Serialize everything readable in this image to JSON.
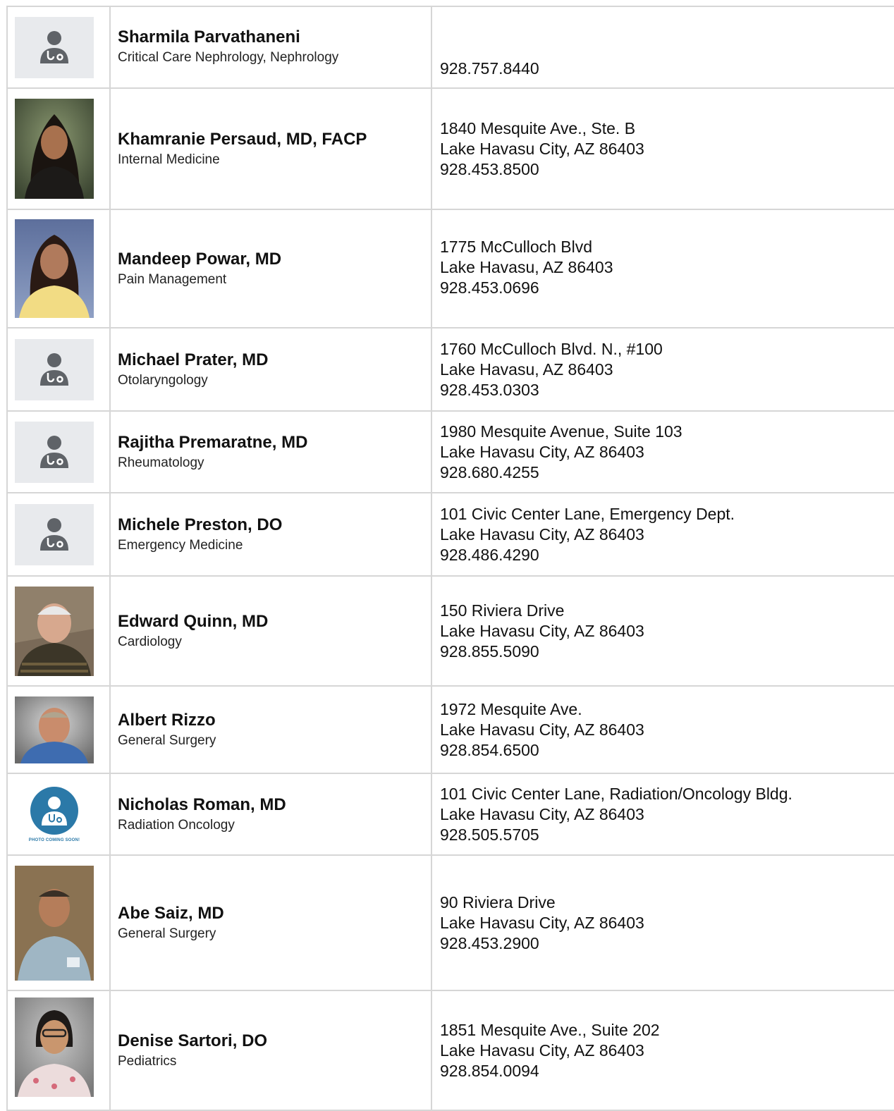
{
  "colors": {
    "border": "#d6d6d6",
    "placeholder_bg": "#e8eaed",
    "placeholder_icon": "#5f6368",
    "coming_soon_blue": "#2b79a8"
  },
  "doctors": [
    {
      "name": "Sharmila Parvathaneni",
      "specialty": "Critical Care Nephrology, Nephrology",
      "address_lines": [
        "",
        "",
        "928.757.8440"
      ],
      "photo_type": "placeholder",
      "icon": "doctor-placeholder-icon"
    },
    {
      "name": "Khamranie Persaud, MD, FACP",
      "specialty": "Internal Medicine",
      "address_lines": [
        "1840 Mesquite Ave., Ste. B",
        "Lake Havasu City, AZ 86403",
        "928.453.8500"
      ],
      "photo_type": "photo"
    },
    {
      "name": "Mandeep Powar, MD",
      "specialty": "Pain Management",
      "address_lines": [
        "1775 McCulloch Blvd",
        "Lake Havasu, AZ 86403",
        "928.453.0696"
      ],
      "photo_type": "photo"
    },
    {
      "name": "Michael Prater, MD",
      "specialty": "Otolaryngology",
      "address_lines": [
        "1760 McCulloch Blvd. N., #100",
        "Lake Havasu, AZ 86403",
        "928.453.0303"
      ],
      "photo_type": "placeholder",
      "icon": "doctor-placeholder-icon"
    },
    {
      "name": "Rajitha Premaratne, MD",
      "specialty": "Rheumatology",
      "address_lines": [
        "1980 Mesquite Avenue, Suite 103",
        "Lake Havasu City, AZ 86403",
        "928.680.4255"
      ],
      "photo_type": "placeholder",
      "icon": "doctor-placeholder-icon"
    },
    {
      "name": "Michele Preston, DO",
      "specialty": "Emergency Medicine",
      "address_lines": [
        "101 Civic Center Lane, Emergency Dept.",
        "Lake Havasu City, AZ 86403",
        "928.486.4290"
      ],
      "photo_type": "placeholder",
      "icon": "doctor-placeholder-icon"
    },
    {
      "name": "Edward Quinn, MD",
      "specialty": "Cardiology",
      "address_lines": [
        "150 Riviera Drive",
        "Lake Havasu City, AZ 86403",
        "928.855.5090"
      ],
      "photo_type": "photo"
    },
    {
      "name": "Albert Rizzo",
      "specialty": "General Surgery",
      "address_lines": [
        "1972 Mesquite Ave.",
        "Lake Havasu City, AZ 86403",
        "928.854.6500"
      ],
      "photo_type": "photo"
    },
    {
      "name": "Nicholas Roman, MD",
      "specialty": "Radiation Oncology",
      "address_lines": [
        "101 Civic Center Lane, Radiation/Oncology Bldg.",
        "Lake Havasu City, AZ 86403",
        "928.505.5705"
      ],
      "photo_type": "coming_soon",
      "photo_caption": "PHOTO COMING SOON!"
    },
    {
      "name": "Abe Saiz, MD",
      "specialty": "General Surgery",
      "address_lines": [
        "90 Riviera Drive",
        "Lake Havasu City, AZ 86403",
        "928.453.2900"
      ],
      "photo_type": "photo"
    },
    {
      "name": "Denise Sartori, DO",
      "specialty": "Pediatrics",
      "address_lines": [
        "1851 Mesquite Ave., Suite 202",
        "Lake Havasu City, AZ 86403",
        "928.854.0094"
      ],
      "photo_type": "photo"
    }
  ]
}
